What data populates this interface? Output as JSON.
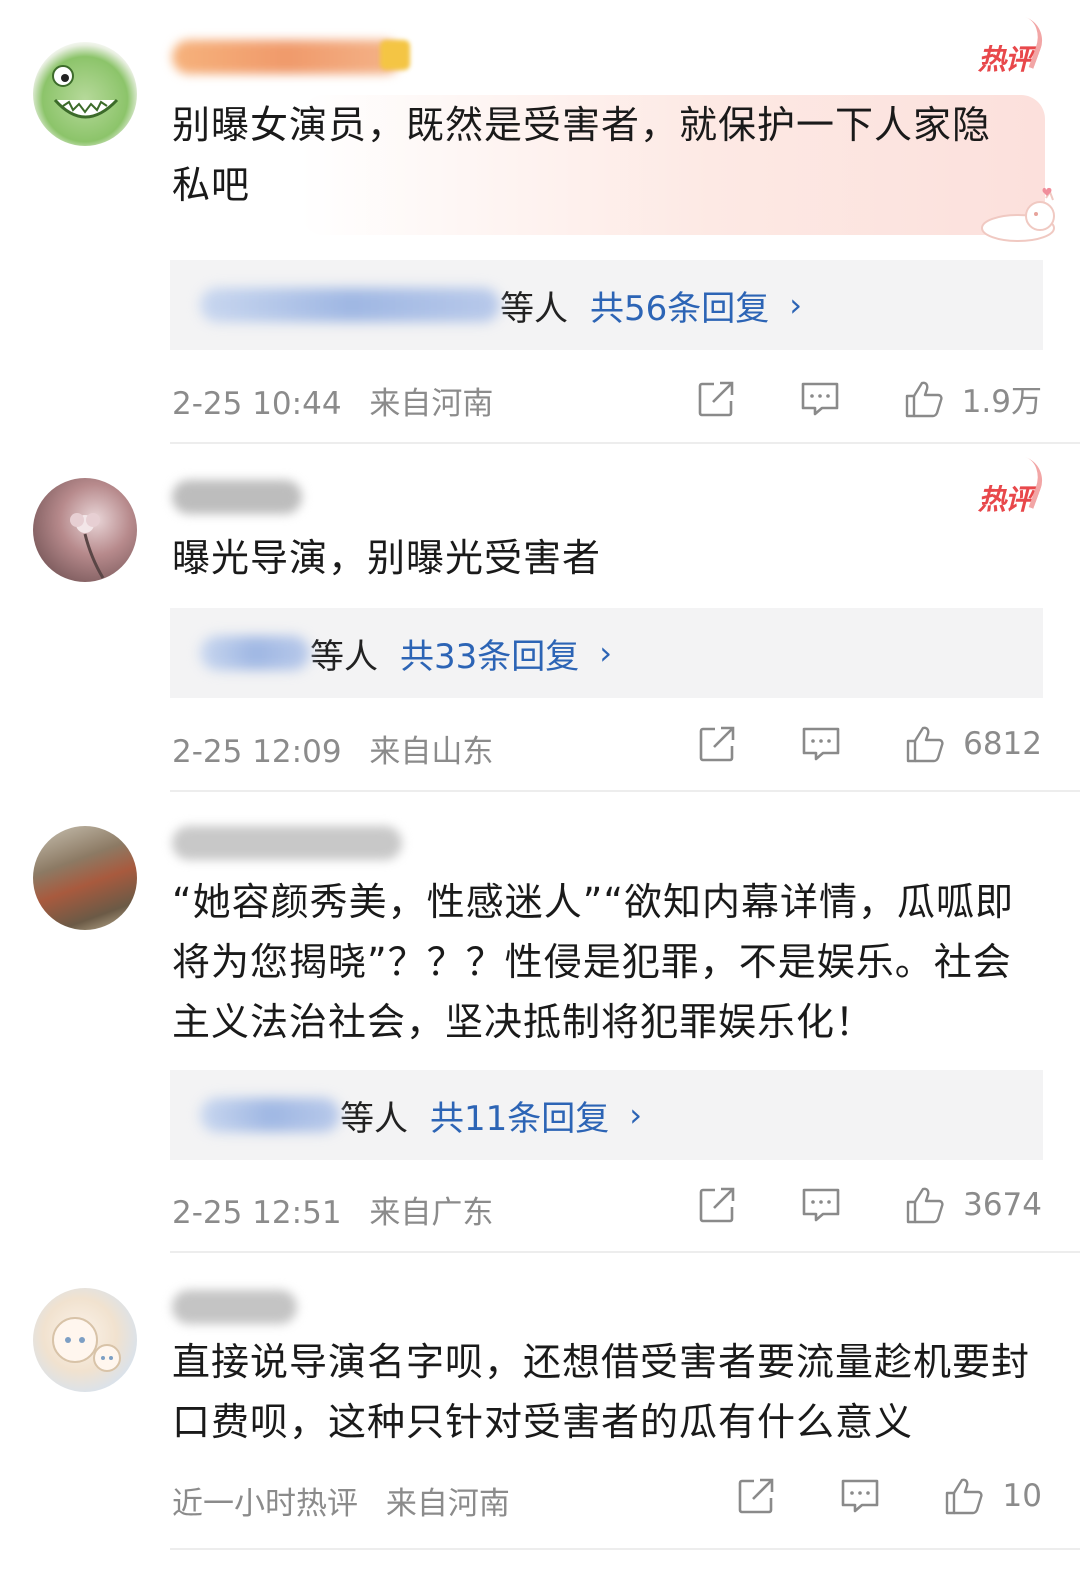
{
  "comments": [
    {
      "hot_tag": "热评",
      "text": "别曝女演员，既然是受害者，就保护一下人家隐私吧",
      "reply_suffix": "等人",
      "reply_count": "共56条回复",
      "reply_chevron": "›",
      "date": "2-25 10:44",
      "location": "来自河南",
      "likes": "1.9万"
    },
    {
      "hot_tag": "热评",
      "text": "曝光导演，别曝光受害者",
      "reply_suffix": "等人",
      "reply_count": "共33条回复",
      "reply_chevron": "›",
      "date": "2-25 12:09",
      "location": "来自山东",
      "likes": "6812"
    },
    {
      "text": "“她容颜秀美，性感迷人”“欲知内幕详情，瓜呱即将为您揭晓”？？？性侵是犯罪，不是娱乐。社会主义法治社会，坚决抵制将犯罪娱乐化！",
      "reply_suffix": "等人",
      "reply_count": "共11条回复",
      "reply_chevron": "›",
      "date": "2-25 12:51",
      "location": "来自广东",
      "likes": "3674"
    },
    {
      "text": "直接说导演名字呗，还想借受害者要流量趁机要封口费呗，这种只针对受害者的瓜有什么意义",
      "date": "近一小时热评",
      "location": "来自河南",
      "likes": "10"
    }
  ],
  "icons": {
    "share": "share-icon",
    "comment": "comment-icon",
    "like": "like-icon"
  },
  "colors": {
    "hot_tag": "#e8484b",
    "reply_link": "#2c64b5",
    "meta_text": "#8b8b8b",
    "reply_box_bg": "#f3f3f4"
  }
}
